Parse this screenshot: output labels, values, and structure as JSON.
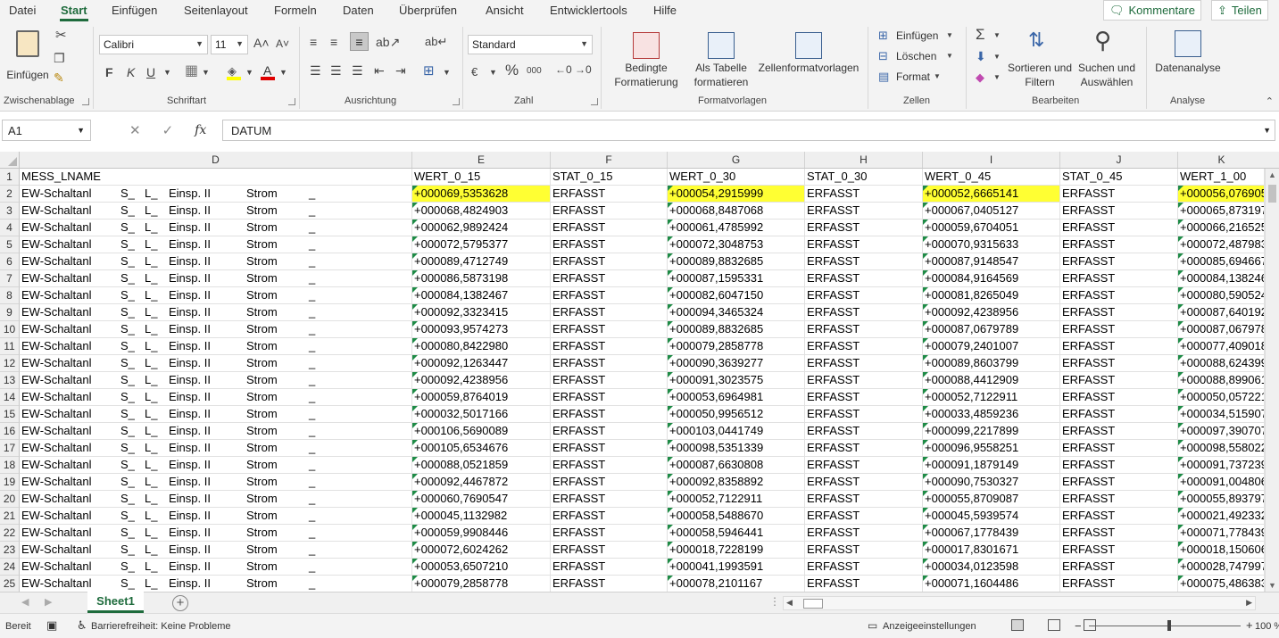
{
  "menu": {
    "tabs": [
      "Datei",
      "Start",
      "Einfügen",
      "Seitenlayout",
      "Formeln",
      "Daten",
      "Überprüfen",
      "Ansicht",
      "Entwicklertools",
      "Hilfe"
    ],
    "comments_label": "Kommentare",
    "share_label": "Teilen"
  },
  "ribbon": {
    "clipboard": {
      "paste_label": "Einfügen",
      "group_label": "Zwischenablage"
    },
    "font": {
      "font_name": "Calibri",
      "font_size": "11",
      "bold": "F",
      "italic": "K",
      "underline": "U",
      "group_label": "Schriftart"
    },
    "alignment": {
      "group_label": "Ausrichtung"
    },
    "number": {
      "format": "Standard",
      "percent": "%",
      "thousands": "000",
      "group_label": "Zahl"
    },
    "styles": {
      "conditional_line1": "Bedingte",
      "conditional_line2": "Formatierung",
      "as_table_line1": "Als Tabelle",
      "as_table_line2": "formatieren",
      "cell_styles": "Zellenformatvorlagen",
      "group_label": "Formatvorlagen"
    },
    "cells": {
      "insert": "Einfügen",
      "delete": "Löschen",
      "format": "Format",
      "group_label": "Zellen"
    },
    "editing": {
      "sort_line1": "Sortieren und",
      "sort_line2": "Filtern",
      "find_line1": "Suchen und",
      "find_line2": "Auswählen",
      "group_label": "Bearbeiten"
    },
    "analysis": {
      "analyze_label": "Datenanalyse",
      "group_label": "Analyse"
    }
  },
  "formula_bar": {
    "name_box": "A1",
    "fx": "fx",
    "content": "DATUM"
  },
  "grid": {
    "columns": [
      "D",
      "E",
      "F",
      "G",
      "H",
      "I",
      "J",
      "K"
    ],
    "header_row": {
      "D": "MESS_LNAME",
      "E": "WERT_0_15",
      "F": "STAT_0_15",
      "G": "WERT_0_30",
      "H": "STAT_0_30",
      "I": "WERT_0_45",
      "J": "STAT_0_45",
      "K": "WERT_1_00"
    },
    "d_parts": [
      "EW-Schaltanl",
      "S_",
      "L_",
      "Einsp. II",
      "Strom",
      "_"
    ],
    "status_value": "ERFASST",
    "rows": [
      {
        "n": "2",
        "E": "+000069,5353628",
        "G": "+000054,2915999",
        "I": "+000052,6665141",
        "K": "+000056,076905"
      },
      {
        "n": "3",
        "E": "+000068,4824903",
        "G": "+000068,8487068",
        "I": "+000067,0405127",
        "K": "+000065,873197"
      },
      {
        "n": "4",
        "E": "+000062,9892424",
        "G": "+000061,4785992",
        "I": "+000059,6704051",
        "K": "+000066,216525"
      },
      {
        "n": "5",
        "E": "+000072,5795377",
        "G": "+000072,3048753",
        "I": "+000070,9315633",
        "K": "+000072,487983"
      },
      {
        "n": "6",
        "E": "+000089,4712749",
        "G": "+000089,8832685",
        "I": "+000087,9148547",
        "K": "+000085,694667"
      },
      {
        "n": "7",
        "E": "+000086,5873198",
        "G": "+000087,1595331",
        "I": "+000084,9164569",
        "K": "+000084,138246"
      },
      {
        "n": "8",
        "E": "+000084,1382467",
        "G": "+000082,6047150",
        "I": "+000081,8265049",
        "K": "+000080,590524"
      },
      {
        "n": "9",
        "E": "+000092,3323415",
        "G": "+000094,3465324",
        "I": "+000092,4238956",
        "K": "+000087,640192"
      },
      {
        "n": "10",
        "E": "+000093,9574273",
        "G": "+000089,8832685",
        "I": "+000087,0679789",
        "K": "+000087,067978"
      },
      {
        "n": "11",
        "E": "+000080,8422980",
        "G": "+000079,2858778",
        "I": "+000079,2401007",
        "K": "+000077,409018"
      },
      {
        "n": "12",
        "E": "+000092,1263447",
        "G": "+000090,3639277",
        "I": "+000089,8603799",
        "K": "+000088,624399"
      },
      {
        "n": "13",
        "E": "+000092,4238956",
        "G": "+000091,3023575",
        "I": "+000088,4412909",
        "K": "+000088,899061"
      },
      {
        "n": "14",
        "E": "+000059,8764019",
        "G": "+000053,6964981",
        "I": "+000052,7122911",
        "K": "+000050,057221"
      },
      {
        "n": "15",
        "E": "+000032,5017166",
        "G": "+000050,9956512",
        "I": "+000033,4859236",
        "K": "+000034,515907"
      },
      {
        "n": "16",
        "E": "+000106,5690089",
        "G": "+000103,0441749",
        "I": "+000099,2217899",
        "K": "+000097,390707"
      },
      {
        "n": "17",
        "E": "+000105,6534676",
        "G": "+000098,5351339",
        "I": "+000096,9558251",
        "K": "+000098,558022"
      },
      {
        "n": "18",
        "E": "+000088,0521859",
        "G": "+000087,6630808",
        "I": "+000091,1879149",
        "K": "+000091,737239"
      },
      {
        "n": "19",
        "E": "+000092,4467872",
        "G": "+000092,8358892",
        "I": "+000090,7530327",
        "K": "+000091,004806"
      },
      {
        "n": "20",
        "E": "+000060,7690547",
        "G": "+000052,7122911",
        "I": "+000055,8709087",
        "K": "+000055,893797"
      },
      {
        "n": "21",
        "E": "+000045,1132982",
        "G": "+000058,5488670",
        "I": "+000045,5939574",
        "K": "+000021,492332"
      },
      {
        "n": "22",
        "E": "+000059,9908446",
        "G": "+000058,5946441",
        "I": "+000067,1778439",
        "K": "+000071,778439"
      },
      {
        "n": "23",
        "E": "+000072,6024262",
        "G": "+000018,7228199",
        "I": "+000017,8301671",
        "K": "+000018,150606"
      },
      {
        "n": "24",
        "E": "+000053,6507210",
        "G": "+000041,1993591",
        "I": "+000034,0123598",
        "K": "+000028,747997"
      },
      {
        "n": "25",
        "E": "+000079,2858778",
        "G": "+000078,2101167",
        "I": "+000071,1604486",
        "K": "+000075,486383"
      }
    ]
  },
  "sheets": {
    "active": "Sheet1",
    "add": "+"
  },
  "status": {
    "ready": "Bereit",
    "accessibility": "Barrierefreiheit: Keine Probleme",
    "display_settings": "Anzeigeeinstellungen",
    "zoom": "100 %"
  },
  "colors": {
    "accent": "#1e6b3c",
    "highlight": "#ffff33",
    "comment_triangle": "#1e8b46"
  }
}
